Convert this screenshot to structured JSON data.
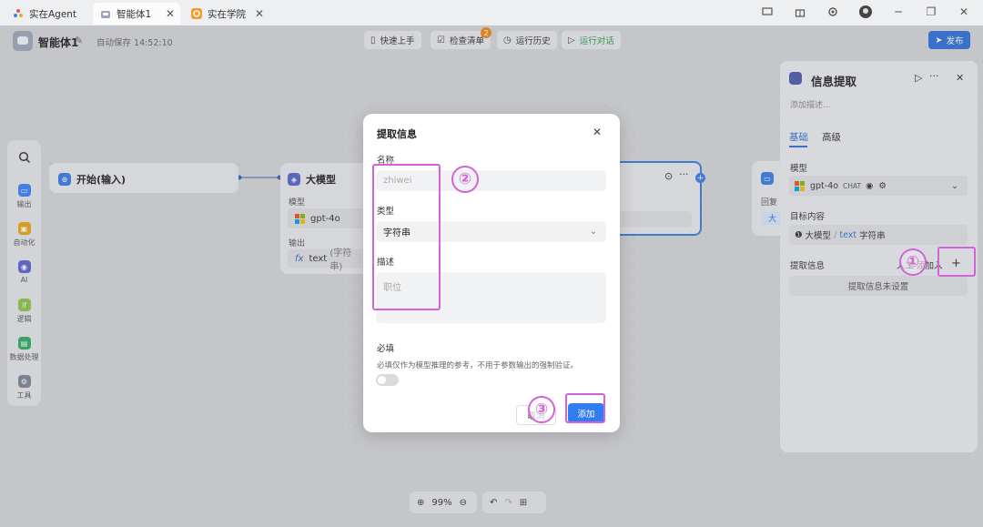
{
  "tabs": [
    {
      "label": "实在Agent",
      "icon": "sparkle-icon"
    },
    {
      "label": "智能体1",
      "icon": "robot-icon"
    },
    {
      "label": "实在学院",
      "icon": "academy-icon"
    }
  ],
  "header": {
    "agent_name": "智能体1",
    "autosave": "自动保存 14:52:10",
    "buttons": {
      "quickstart": "快速上手",
      "checklist": "检查清单",
      "checklist_badge": "2",
      "history": "运行历史",
      "run_chat": "运行对话",
      "publish": "发布"
    }
  },
  "left_toolbar": [
    "输出",
    "自动化",
    "AI",
    "逻辑",
    "数据处理",
    "工具"
  ],
  "nodes": {
    "start": {
      "title": "开始(输入)"
    },
    "llm": {
      "title": "大模型",
      "model_label": "模型",
      "model_value": "gpt-4o",
      "output_label": "输出",
      "output_value": "text",
      "output_type": "(字符串)",
      "fx": "fx"
    },
    "right_node": {
      "label": "回复",
      "tag": "大"
    }
  },
  "zoom": {
    "value": "99%"
  },
  "right_panel": {
    "title": "信息提取",
    "desc_placeholder": "添加描述...",
    "tabs": {
      "basic": "基础",
      "advanced": "高级"
    },
    "model_label": "模型",
    "model_value": "gpt-4o",
    "model_chip": "CHAT",
    "target_label": "目标内容",
    "target_prefix": "大模型",
    "target_sep": "/",
    "target_var": "text",
    "target_type": "字符串",
    "extract_label": "提取信息",
    "manual_add": "人工 添加入",
    "add_symbol": "+",
    "extract_empty": "提取信息未设置"
  },
  "dialog": {
    "title": "提取信息",
    "name_label": "名称",
    "name_placeholder": "zhiwei",
    "type_label": "类型",
    "type_value": "字符串",
    "desc_label": "描述",
    "desc_placeholder": "职位",
    "required_label": "必填",
    "required_hint": "必填仅作为模型推理的参考，不用于参数输出的强制验证。",
    "cancel": "取消",
    "add": "添加"
  },
  "annotations": {
    "one": "①",
    "two": "②",
    "three": "③"
  },
  "colors": {
    "accent": "#2f6fd6",
    "annotation": "#d463d9",
    "run_green": "#2f9d4a"
  }
}
